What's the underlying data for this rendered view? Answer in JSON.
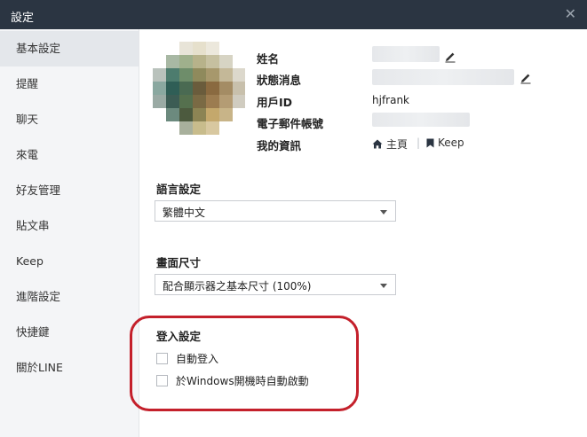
{
  "window": {
    "title": "設定"
  },
  "sidebar": {
    "items": [
      {
        "label": "基本設定",
        "active": true
      },
      {
        "label": "提醒"
      },
      {
        "label": "聊天"
      },
      {
        "label": "來電"
      },
      {
        "label": "好友管理"
      },
      {
        "label": "貼文串"
      },
      {
        "label": "Keep"
      },
      {
        "label": "進階設定"
      },
      {
        "label": "快捷鍵"
      },
      {
        "label": "關於LINE"
      }
    ]
  },
  "profile": {
    "name_label": "姓名",
    "status_label": "狀態消息",
    "userid_label": "用戶ID",
    "userid_value": "hjfrank",
    "email_label": "電子郵件帳號",
    "myinfo_label": "我的資訊",
    "home_link": "主頁",
    "keep_link": "Keep"
  },
  "language": {
    "title": "語言設定",
    "selected": "繁體中文"
  },
  "display": {
    "title": "畫面尺寸",
    "selected": "配合顯示器之基本尺寸 (100%)"
  },
  "login": {
    "title": "登入設定",
    "auto_login": {
      "label": "自動登入",
      "checked": false
    },
    "auto_start": {
      "label": "於Windows開機時自動啟動",
      "checked": false
    }
  },
  "colors": {
    "titlebar": "#2b3542",
    "highlight": "#c4202b",
    "sidebar_bg": "#f4f5f7"
  }
}
